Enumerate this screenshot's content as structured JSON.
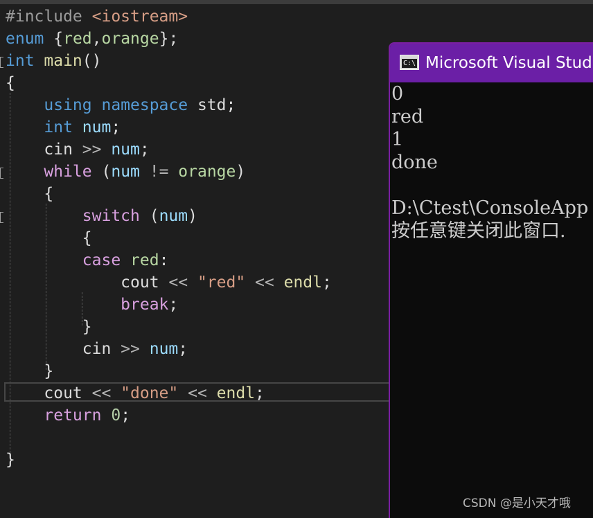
{
  "editor": {
    "lines": [
      [
        {
          "t": "#include ",
          "c": "pp"
        },
        {
          "t": "<iostream>",
          "c": "inc"
        }
      ],
      [
        {
          "t": "enum ",
          "c": "kw"
        },
        {
          "t": "{",
          "c": "plain"
        },
        {
          "t": "red",
          "c": "enum"
        },
        {
          "t": ",",
          "c": "plain"
        },
        {
          "t": "orange",
          "c": "enum"
        },
        {
          "t": "};",
          "c": "plain"
        }
      ],
      [
        {
          "t": "int ",
          "c": "kw"
        },
        {
          "t": "main",
          "c": "fn"
        },
        {
          "t": "()",
          "c": "plain"
        }
      ],
      [
        {
          "t": "{",
          "c": "plain"
        }
      ],
      [
        {
          "t": "    using namespace ",
          "c": "kw"
        },
        {
          "t": "std;",
          "c": "plain"
        }
      ],
      [
        {
          "t": "    int ",
          "c": "kw"
        },
        {
          "t": "num",
          "c": "var"
        },
        {
          "t": ";",
          "c": "plain"
        }
      ],
      [
        {
          "t": "    cin ",
          "c": "plain"
        },
        {
          "t": ">> ",
          "c": "op"
        },
        {
          "t": "num",
          "c": "var"
        },
        {
          "t": ";",
          "c": "plain"
        }
      ],
      [
        {
          "t": "    while ",
          "c": "ctl"
        },
        {
          "t": "(",
          "c": "plain"
        },
        {
          "t": "num ",
          "c": "var"
        },
        {
          "t": "!= ",
          "c": "op"
        },
        {
          "t": "orange",
          "c": "enum"
        },
        {
          "t": ")",
          "c": "plain"
        }
      ],
      [
        {
          "t": "    {",
          "c": "plain"
        }
      ],
      [
        {
          "t": "        switch ",
          "c": "ctl"
        },
        {
          "t": "(",
          "c": "plain"
        },
        {
          "t": "num",
          "c": "var"
        },
        {
          "t": ")",
          "c": "plain"
        }
      ],
      [
        {
          "t": "        {",
          "c": "plain"
        }
      ],
      [
        {
          "t": "        case ",
          "c": "ctl"
        },
        {
          "t": "red",
          "c": "enum"
        },
        {
          "t": ":",
          "c": "plain"
        }
      ],
      [
        {
          "t": "            cout ",
          "c": "plain"
        },
        {
          "t": "<< ",
          "c": "op"
        },
        {
          "t": "\"red\" ",
          "c": "str"
        },
        {
          "t": "<< ",
          "c": "op"
        },
        {
          "t": "endl",
          "c": "fn"
        },
        {
          "t": ";",
          "c": "plain"
        }
      ],
      [
        {
          "t": "            break",
          "c": "ctl"
        },
        {
          "t": ";",
          "c": "plain"
        }
      ],
      [
        {
          "t": "        }",
          "c": "plain"
        }
      ],
      [
        {
          "t": "        cin ",
          "c": "plain"
        },
        {
          "t": ">> ",
          "c": "op"
        },
        {
          "t": "num",
          "c": "var"
        },
        {
          "t": ";",
          "c": "plain"
        }
      ],
      [
        {
          "t": "    }",
          "c": "plain"
        }
      ],
      [
        {
          "t": "    cout ",
          "c": "plain"
        },
        {
          "t": "<< ",
          "c": "op"
        },
        {
          "t": "\"done\" ",
          "c": "str"
        },
        {
          "t": "<< ",
          "c": "op"
        },
        {
          "t": "endl",
          "c": "fn"
        },
        {
          "t": ";",
          "c": "plain"
        }
      ],
      [
        {
          "t": "    return ",
          "c": "ctl"
        },
        {
          "t": "0",
          "c": "num"
        },
        {
          "t": ";",
          "c": "plain"
        }
      ],
      [],
      [
        {
          "t": "}",
          "c": "plain"
        }
      ]
    ],
    "colors": {
      "background": "#1e1e1e",
      "keyword": "#569cd6",
      "control": "#d8a0df",
      "enum_member": "#b8d7a3",
      "function": "#dcdcaa",
      "variable": "#9cdcfe",
      "string": "#d69d85",
      "number": "#b5cea8",
      "text": "#dcdcdc"
    }
  },
  "console": {
    "title": "Microsoft Visual Studio",
    "icon_label": "C:\\",
    "icon": "console-window-icon",
    "lines": [
      "0",
      "red",
      "1",
      "done",
      "",
      "D:\\Ctest\\ConsoleApp",
      "按任意键关闭此窗口."
    ],
    "colors": {
      "titlebar": "#6b1fa6",
      "background": "#0c0c0c",
      "text": "#cccccc"
    }
  },
  "watermark": "CSDN @是小天才哦"
}
